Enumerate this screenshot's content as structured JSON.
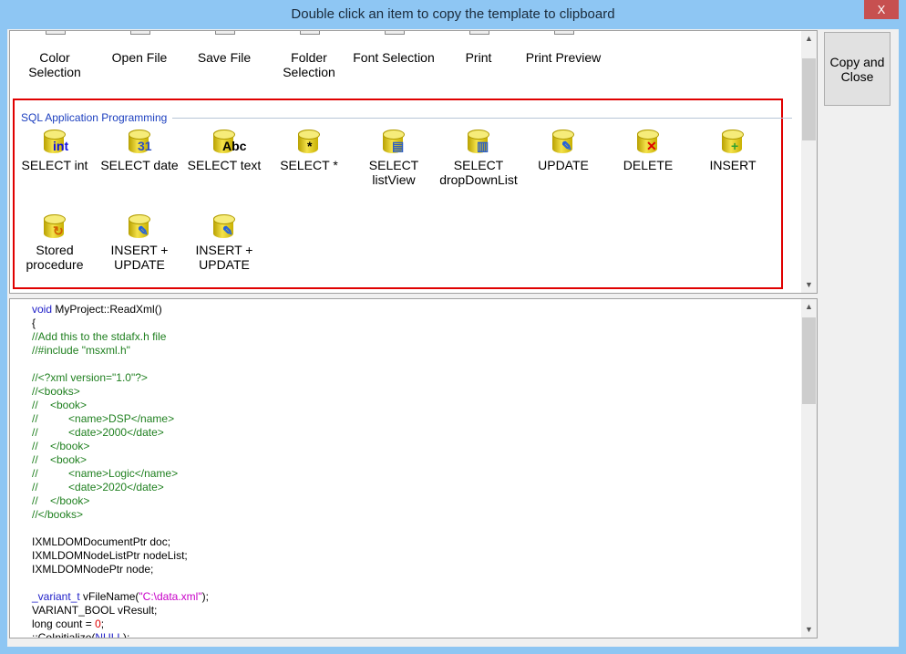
{
  "window": {
    "title": "Double click an item to copy the template to clipboard",
    "close_label": "X"
  },
  "copy_button": {
    "label": "Copy and Close"
  },
  "dialog_items": [
    {
      "label": "Color Selection",
      "icon": "color-palette-icon"
    },
    {
      "label": "Open File",
      "icon": "folder-open-icon"
    },
    {
      "label": "Save File",
      "icon": "floppy-disk-icon"
    },
    {
      "label": "Folder Selection",
      "icon": "cabinet-icon"
    },
    {
      "label": "Font Selection",
      "icon": "font-icon"
    },
    {
      "label": "Print",
      "icon": "printer-icon"
    },
    {
      "label": "Print Preview",
      "icon": "magnifier-icon"
    }
  ],
  "sql_group": {
    "title": "SQL Application Programming",
    "items": [
      {
        "label": "SELECT int",
        "overlay": "int",
        "icon": "database-int-icon"
      },
      {
        "label": "SELECT date",
        "overlay": "31",
        "icon": "database-date-icon"
      },
      {
        "label": "SELECT text",
        "overlay": "Abc",
        "icon": "database-text-icon"
      },
      {
        "label": "SELECT *",
        "overlay": "*",
        "icon": "database-star-icon"
      },
      {
        "label": "SELECT listView",
        "overlay": "▤",
        "icon": "database-listview-icon"
      },
      {
        "label": "SELECT dropDownList",
        "overlay": "▥",
        "icon": "database-dropdown-icon"
      },
      {
        "label": "UPDATE",
        "overlay": "✎",
        "icon": "database-update-icon"
      },
      {
        "label": "DELETE",
        "overlay": "✕",
        "icon": "database-delete-icon"
      },
      {
        "label": "INSERT",
        "overlay": "+",
        "icon": "database-insert-icon"
      },
      {
        "label": "Stored procedure",
        "overlay": "↻",
        "icon": "database-procedure-icon"
      },
      {
        "label": "INSERT + UPDATE",
        "overlay": "✎",
        "icon": "database-insert-update-icon"
      },
      {
        "label": "INSERT + UPDATE",
        "overlay": "✎",
        "icon": "database-insert-update-icon-2"
      }
    ]
  },
  "colors": {
    "keyword": "#2020c8",
    "comment": "#208020",
    "string": "#c800c8",
    "number": "#e00000",
    "text": "#000000",
    "highlight_border": "#e00000"
  },
  "code_lines": [
    [
      [
        "keyword",
        "void"
      ],
      [
        "text",
        " MyProject::ReadXml()"
      ]
    ],
    [
      [
        "text",
        "{"
      ]
    ],
    [
      [
        "comment",
        "//Add this to the stdafx.h file"
      ]
    ],
    [
      [
        "comment",
        "//#include \"msxml.h\""
      ]
    ],
    [],
    [
      [
        "comment",
        "//<?xml version=\"1.0\"?>"
      ]
    ],
    [
      [
        "comment",
        "//<books>"
      ]
    ],
    [
      [
        "comment",
        "//    <book>"
      ]
    ],
    [
      [
        "comment",
        "//          <name>DSP</name>"
      ]
    ],
    [
      [
        "comment",
        "//          <date>2000</date>"
      ]
    ],
    [
      [
        "comment",
        "//    </book>"
      ]
    ],
    [
      [
        "comment",
        "//    <book>"
      ]
    ],
    [
      [
        "comment",
        "//          <name>Logic</name>"
      ]
    ],
    [
      [
        "comment",
        "//          <date>2020</date>"
      ]
    ],
    [
      [
        "comment",
        "//    </book>"
      ]
    ],
    [
      [
        "comment",
        "//</books>"
      ]
    ],
    [],
    [
      [
        "text",
        "IXMLDOMDocumentPtr doc;"
      ]
    ],
    [
      [
        "text",
        "IXMLDOMNodeListPtr nodeList;"
      ]
    ],
    [
      [
        "text",
        "IXMLDOMNodePtr node;"
      ]
    ],
    [],
    [
      [
        "keyword",
        "_variant_t"
      ],
      [
        "text",
        " vFileName("
      ],
      [
        "string",
        "\"C:\\data.xml\""
      ],
      [
        "text",
        ");"
      ]
    ],
    [
      [
        "text",
        "VARIANT_BOOL vResult;"
      ]
    ],
    [
      [
        "text",
        "long count = "
      ],
      [
        "number",
        "0"
      ],
      [
        "text",
        ";"
      ]
    ],
    [
      [
        "text",
        "::CoInitialize("
      ],
      [
        "keyword",
        "NULL"
      ],
      [
        "text",
        ");"
      ]
    ]
  ]
}
